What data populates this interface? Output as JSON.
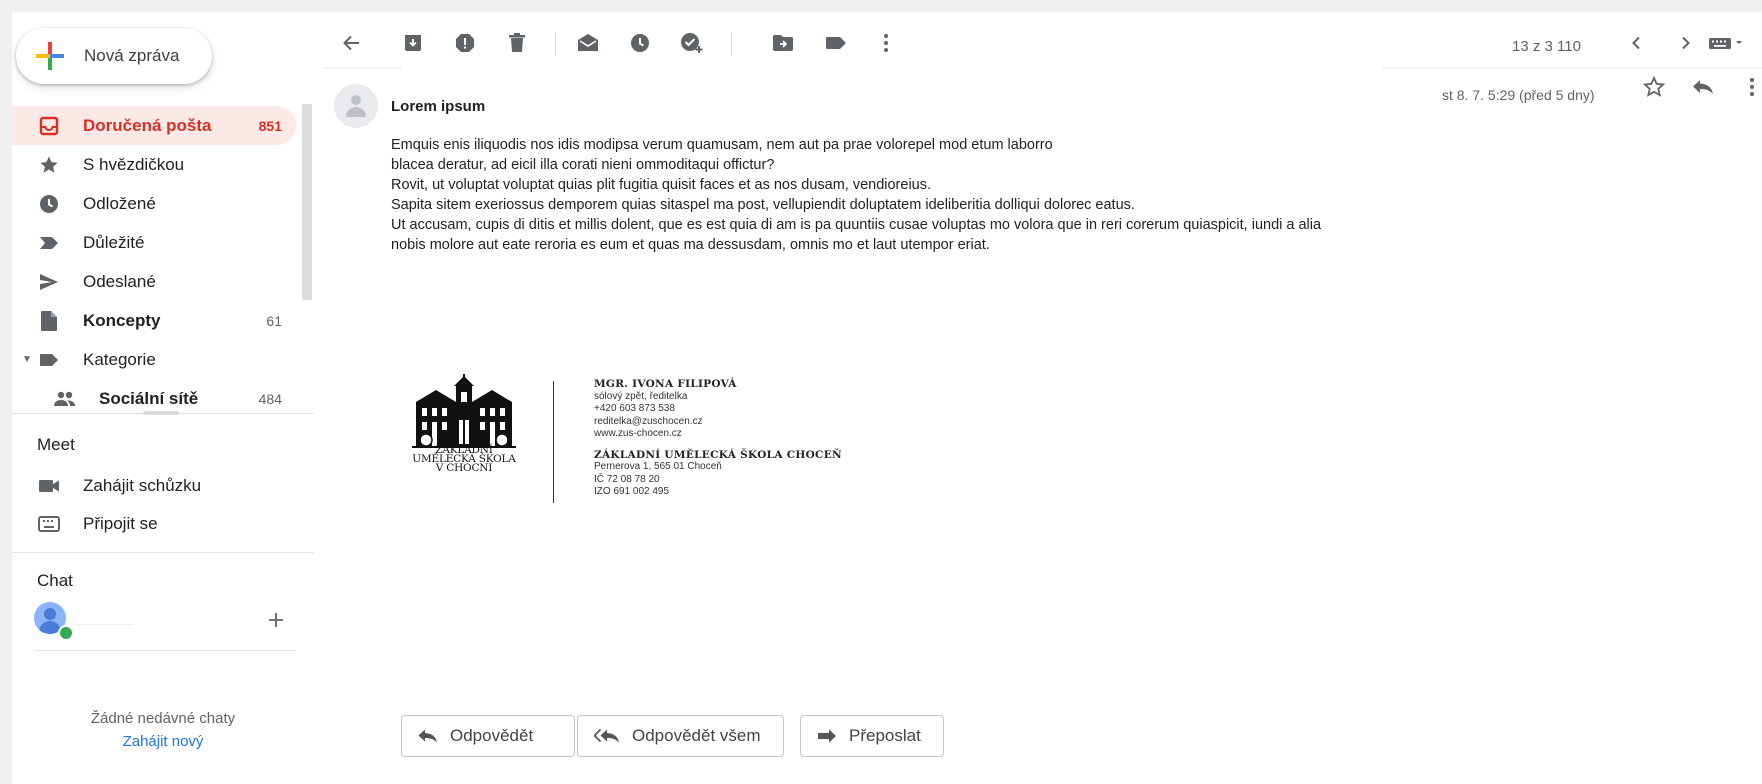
{
  "compose": {
    "label": "Nová zpráva"
  },
  "nav": {
    "items": [
      {
        "label": "Doručená pošta",
        "count": "851",
        "icon": "inbox-icon"
      },
      {
        "label": "S hvězdičkou",
        "count": "",
        "icon": "star-icon"
      },
      {
        "label": "Odložené",
        "count": "",
        "icon": "clock-icon"
      },
      {
        "label": "Důležité",
        "count": "",
        "icon": "important-icon"
      },
      {
        "label": "Odeslané",
        "count": "",
        "icon": "send-icon"
      },
      {
        "label": "Koncepty",
        "count": "61",
        "icon": "draft-icon"
      },
      {
        "label": "Kategorie",
        "count": "",
        "icon": "label-icon"
      },
      {
        "label": "Sociální sítě",
        "count": "484",
        "icon": "people-icon"
      }
    ]
  },
  "meet": {
    "title": "Meet",
    "items": [
      {
        "label": "Zahájit schůzku",
        "icon": "video-icon"
      },
      {
        "label": "Připojit se",
        "icon": "keyboard-icon"
      }
    ]
  },
  "chat": {
    "title": "Chat",
    "empty_text": "Žádné nedávné chaty",
    "start_link": "Zahájit nový"
  },
  "toolbar": {
    "pager": "13 z 3 110",
    "icons": [
      "back-arrow-icon",
      "archive-icon",
      "report-spam-icon",
      "delete-icon",
      "mark-unread-icon",
      "snooze-icon",
      "add-task-icon",
      "move-to-icon",
      "label-icon",
      "more-vert-icon",
      "chevron-left-icon",
      "chevron-right-icon",
      "keyboard-icon"
    ]
  },
  "message": {
    "sender": "Lorem ipsum",
    "date": "st 8. 7. 5:29 (před 5 dny)",
    "body": [
      "Emquis enis iliquodis nos idis modipsa verum quamusam, nem aut pa prae volorepel mod etum laborro",
      "blacea deratur, ad eicil illa corati nieni ommoditaqui offictur?",
      "Rovit, ut voluptat voluptat quias plit fugitia quisit faces et as nos dusam, vendioreius.",
      "Sapita sitem exeriossus demporem quias sitaspel ma post, vellupiendit doluptatem ideliberitia dolliqui dolorec eatus.",
      "Ut accusam, cupis di ditis et millis dolent, que es est quia di am is pa quuntiis cusae voluptas mo volora que in reri corerum quiaspicit, iundi a alia",
      "nobis molore aut eate reroria es eum et quas ma dessusdam, omnis mo et laut utempor eriat."
    ]
  },
  "signature": {
    "logo_text": [
      "ZÁKLADNÍ",
      "UMĚLECKÁ ŠKOLA",
      "V CHOCNI"
    ],
    "name": "MGR. IVONA FILIPOVÁ",
    "role": "sólový zpět, ředitelka",
    "phone": "+420 603 873 538",
    "email": "reditelka@zuschocen.cz",
    "web": "www.zus-chocen.cz",
    "school": "ZÁKLADNÍ UMĚLECKÁ ŠKOLA CHOCEŇ",
    "address": "Pernerova 1, 565 01 Choceň",
    "ic": "IČ 72 08 78 20",
    "izo": "IZO 691 002 495"
  },
  "actions": {
    "reply": "Odpovědět",
    "reply_all": "Odpovědět všem",
    "forward": "Přeposlat"
  },
  "colors": {
    "accent_red": "#d93025",
    "active_bg": "#fce8e6",
    "link_blue": "#1a73e8"
  }
}
